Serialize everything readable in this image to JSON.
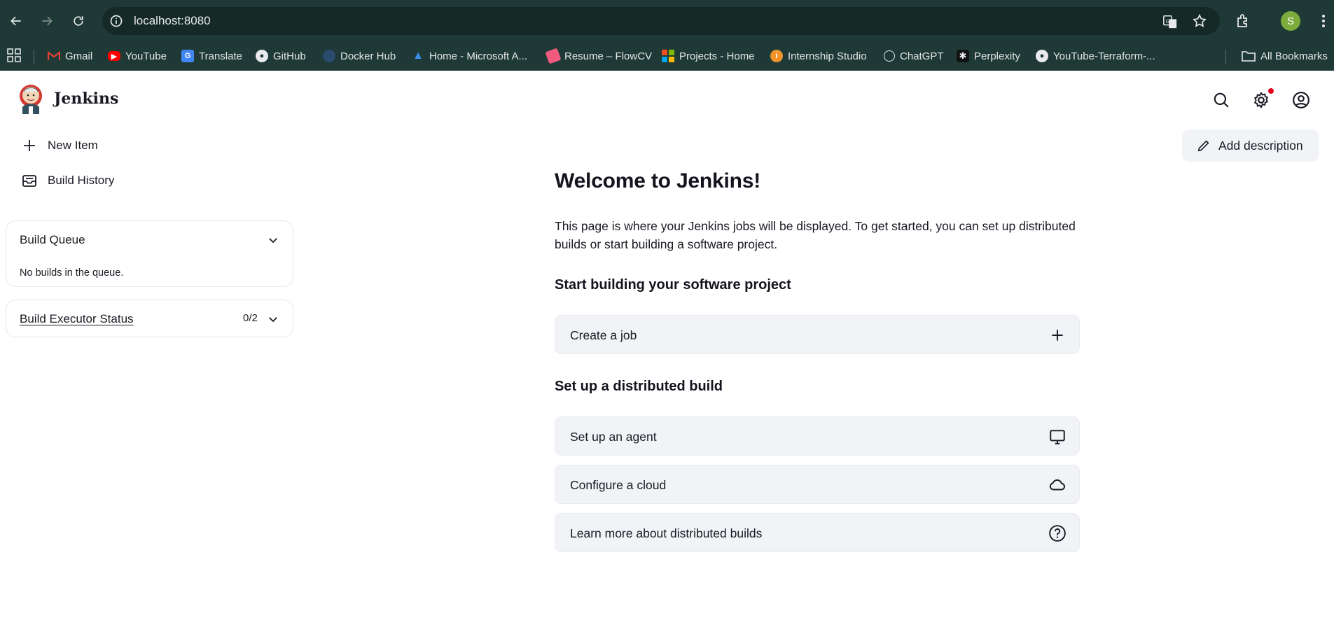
{
  "browser": {
    "url": "localhost:8080",
    "profile_initial": "S",
    "bookmarks": [
      {
        "label": "Gmail",
        "icon": "gmail-icon"
      },
      {
        "label": "YouTube",
        "icon": "youtube-icon"
      },
      {
        "label": "Translate",
        "icon": "translate-icon"
      },
      {
        "label": "GitHub",
        "icon": "github-icon"
      },
      {
        "label": "Docker Hub",
        "icon": "docker-icon"
      },
      {
        "label": "Home - Microsoft A...",
        "icon": "azure-icon"
      },
      {
        "label": "Resume – FlowCV",
        "icon": "flowcv-icon"
      },
      {
        "label": "Projects - Home",
        "icon": "microsoft-icon"
      },
      {
        "label": "Internship Studio",
        "icon": "internship-studio-icon"
      },
      {
        "label": "ChatGPT",
        "icon": "chatgpt-icon"
      },
      {
        "label": "Perplexity",
        "icon": "perplexity-icon"
      },
      {
        "label": "YouTube-Terraform-...",
        "icon": "github-icon"
      }
    ],
    "all_bookmarks_label": "All Bookmarks"
  },
  "header": {
    "brand": "Jenkins"
  },
  "sidebar": {
    "links": [
      {
        "label": "New Item",
        "icon": "plus-icon"
      },
      {
        "label": "Build History",
        "icon": "inbox-icon"
      }
    ],
    "build_queue": {
      "title": "Build Queue",
      "empty_text": "No builds in the queue."
    },
    "executor_status": {
      "title": "Build Executor Status",
      "count": "0/2"
    }
  },
  "main": {
    "add_description_label": "Add description",
    "welcome_title": "Welcome to Jenkins!",
    "intro_text": "This page is where your Jenkins jobs will be displayed. To get started, you can set up distributed builds or start building a software project.",
    "section_software": {
      "title": "Start building your software project",
      "actions": [
        {
          "label": "Create a job",
          "icon": "plus-icon"
        }
      ]
    },
    "section_distributed": {
      "title": "Set up a distributed build",
      "actions": [
        {
          "label": "Set up an agent",
          "icon": "monitor-icon"
        },
        {
          "label": "Configure a cloud",
          "icon": "cloud-icon"
        },
        {
          "label": "Learn more about distributed builds",
          "icon": "help-circle-icon"
        }
      ]
    }
  },
  "colors": {
    "chrome_bg": "#1f3a36",
    "card_bg": "#f1f3f6",
    "notification_dot": "#e6001f",
    "profile_avatar": "#7cab3c"
  }
}
